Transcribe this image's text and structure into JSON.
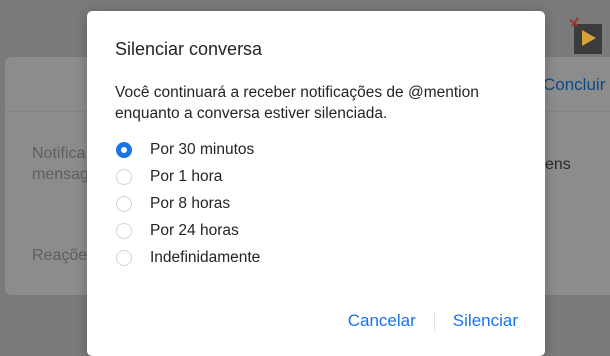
{
  "background": {
    "link_right": "Concluir",
    "setting_1_line1": "Notifica",
    "setting_1_line2": "mensag",
    "setting_1_right": "ens",
    "setting_2": "Reaçõe"
  },
  "dialog": {
    "title": "Silenciar conversa",
    "description": "Você continuará a receber notificações de @mention enquanto a conversa estiver silenciada.",
    "options": [
      {
        "label": "Por 30 minutos",
        "checked": true
      },
      {
        "label": "Por 1 hora",
        "checked": false
      },
      {
        "label": "Por 8 horas",
        "checked": false
      },
      {
        "label": "Por 24 horas",
        "checked": false
      },
      {
        "label": "Indefinidamente",
        "checked": false
      }
    ],
    "cancel_label": "Cancelar",
    "confirm_label": "Silenciar"
  },
  "colors": {
    "accent": "#1a73e8",
    "overlay": "#7a7a7a",
    "text": "#252423"
  }
}
